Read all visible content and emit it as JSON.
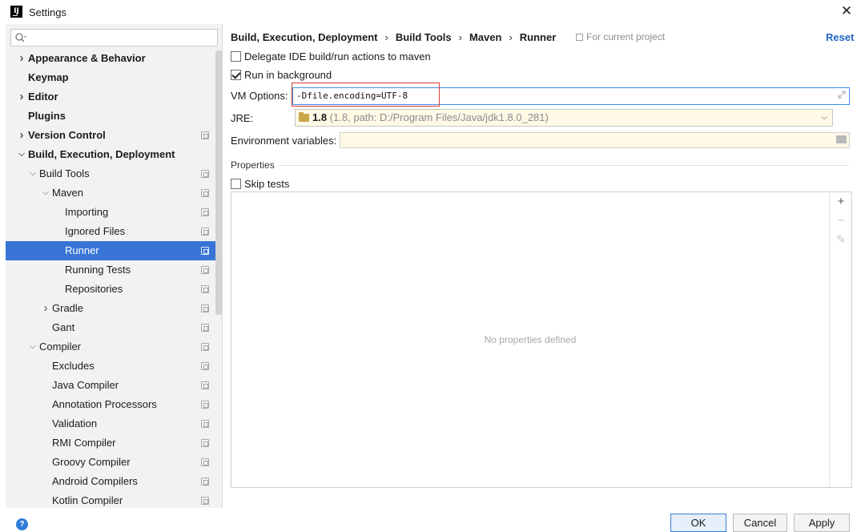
{
  "window": {
    "title": "Settings",
    "app_icon": "IJ"
  },
  "sidebar": {
    "search_placeholder": "",
    "items": [
      {
        "label": "Appearance & Behavior",
        "level": 0,
        "bold": true,
        "chevron": "right",
        "project": false,
        "selected": false
      },
      {
        "label": "Keymap",
        "level": 0,
        "bold": true,
        "chevron": "",
        "project": false,
        "selected": false
      },
      {
        "label": "Editor",
        "level": 0,
        "bold": true,
        "chevron": "right",
        "project": false,
        "selected": false
      },
      {
        "label": "Plugins",
        "level": 0,
        "bold": true,
        "chevron": "",
        "project": false,
        "selected": false
      },
      {
        "label": "Version Control",
        "level": 0,
        "bold": true,
        "chevron": "right",
        "project": true,
        "selected": false
      },
      {
        "label": "Build, Execution, Deployment",
        "level": 0,
        "bold": true,
        "chevron": "down",
        "project": false,
        "selected": false
      },
      {
        "label": "Build Tools",
        "level": 1,
        "bold": false,
        "chevron": "down",
        "project": true,
        "selected": false
      },
      {
        "label": "Maven",
        "level": 2,
        "bold": false,
        "chevron": "down",
        "project": true,
        "selected": false
      },
      {
        "label": "Importing",
        "level": 3,
        "bold": false,
        "chevron": "",
        "project": true,
        "selected": false
      },
      {
        "label": "Ignored Files",
        "level": 3,
        "bold": false,
        "chevron": "",
        "project": true,
        "selected": false
      },
      {
        "label": "Runner",
        "level": 3,
        "bold": false,
        "chevron": "",
        "project": true,
        "selected": true
      },
      {
        "label": "Running Tests",
        "level": 3,
        "bold": false,
        "chevron": "",
        "project": true,
        "selected": false
      },
      {
        "label": "Repositories",
        "level": 3,
        "bold": false,
        "chevron": "",
        "project": true,
        "selected": false
      },
      {
        "label": "Gradle",
        "level": 2,
        "bold": false,
        "chevron": "right",
        "project": true,
        "selected": false
      },
      {
        "label": "Gant",
        "level": 2,
        "bold": false,
        "chevron": "",
        "project": true,
        "selected": false
      },
      {
        "label": "Compiler",
        "level": 1,
        "bold": false,
        "chevron": "down",
        "project": true,
        "selected": false
      },
      {
        "label": "Excludes",
        "level": 2,
        "bold": false,
        "chevron": "",
        "project": true,
        "selected": false
      },
      {
        "label": "Java Compiler",
        "level": 2,
        "bold": false,
        "chevron": "",
        "project": true,
        "selected": false
      },
      {
        "label": "Annotation Processors",
        "level": 2,
        "bold": false,
        "chevron": "",
        "project": true,
        "selected": false
      },
      {
        "label": "Validation",
        "level": 2,
        "bold": false,
        "chevron": "",
        "project": true,
        "selected": false
      },
      {
        "label": "RMI Compiler",
        "level": 2,
        "bold": false,
        "chevron": "",
        "project": true,
        "selected": false
      },
      {
        "label": "Groovy Compiler",
        "level": 2,
        "bold": false,
        "chevron": "",
        "project": true,
        "selected": false
      },
      {
        "label": "Android Compilers",
        "level": 2,
        "bold": false,
        "chevron": "",
        "project": true,
        "selected": false
      },
      {
        "label": "Kotlin Compiler",
        "level": 2,
        "bold": false,
        "chevron": "",
        "project": true,
        "selected": false
      }
    ]
  },
  "main": {
    "breadcrumb": [
      "Build, Execution, Deployment",
      "Build Tools",
      "Maven",
      "Runner"
    ],
    "breadcrumb_sep": "›",
    "for_current_project": "For current project",
    "reset_label": "Reset",
    "delegate_label": "Delegate IDE build/run actions to maven",
    "delegate_checked": false,
    "run_bg_label": "Run in background",
    "run_bg_checked": true,
    "vm_options_label": "VM Options:",
    "vm_options_value": "-Dfile.encoding=UTF-8",
    "jre_label": "JRE:",
    "jre_version": "1.8",
    "jre_path": "(1.8, path: D:/Program Files/Java/jdk1.8.0_281)",
    "env_label": "Environment variables:",
    "env_value": "",
    "properties_section": "Properties",
    "skip_tests_label": "Skip tests",
    "skip_tests_checked": false,
    "no_properties": "No properties defined"
  },
  "buttons": {
    "ok": "OK",
    "cancel": "Cancel",
    "apply": "Apply",
    "help": "?"
  },
  "colors": {
    "selection": "#3875d7",
    "link": "#2166c9",
    "highlight_box": "#e23b3b",
    "input_focus": "#3d8ee6"
  }
}
